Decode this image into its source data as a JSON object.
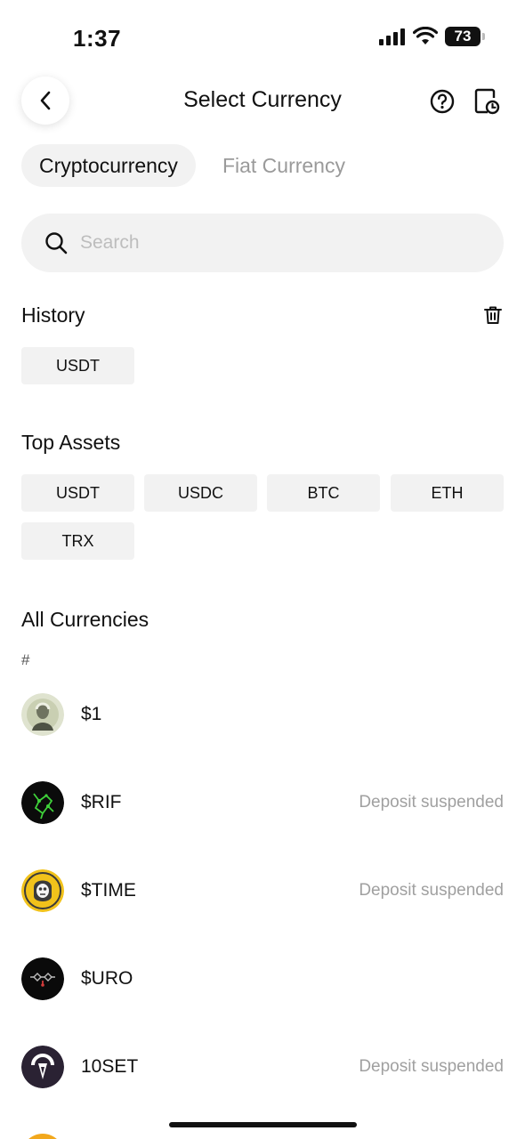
{
  "status_bar": {
    "time": "1:37",
    "battery": "73"
  },
  "header": {
    "title": "Select Currency"
  },
  "tabs": [
    {
      "label": "Cryptocurrency",
      "active": true
    },
    {
      "label": "Fiat Currency",
      "active": false
    }
  ],
  "search": {
    "placeholder": "Search",
    "value": ""
  },
  "history": {
    "title": "History",
    "items": [
      "USDT"
    ]
  },
  "top_assets": {
    "title": "Top Assets",
    "items": [
      "USDT",
      "USDC",
      "BTC",
      "ETH",
      "TRX"
    ]
  },
  "all_currencies": {
    "title": "All Currencies",
    "index_letter": "#",
    "items": [
      {
        "name": "$1",
        "status": "",
        "icon": "one-dollar-icon"
      },
      {
        "name": "$RIF",
        "status": "Deposit suspended",
        "icon": "rif-icon"
      },
      {
        "name": "$TIME",
        "status": "Deposit suspended",
        "icon": "time-icon"
      },
      {
        "name": "$URO",
        "status": "",
        "icon": "uro-icon"
      },
      {
        "name": "10SET",
        "status": "Deposit suspended",
        "icon": "tenset-icon"
      }
    ]
  },
  "colors": {
    "chip_bg": "#f2f2f2",
    "muted_text": "#9a9a9a",
    "accent_orange": "#f2a81d"
  }
}
